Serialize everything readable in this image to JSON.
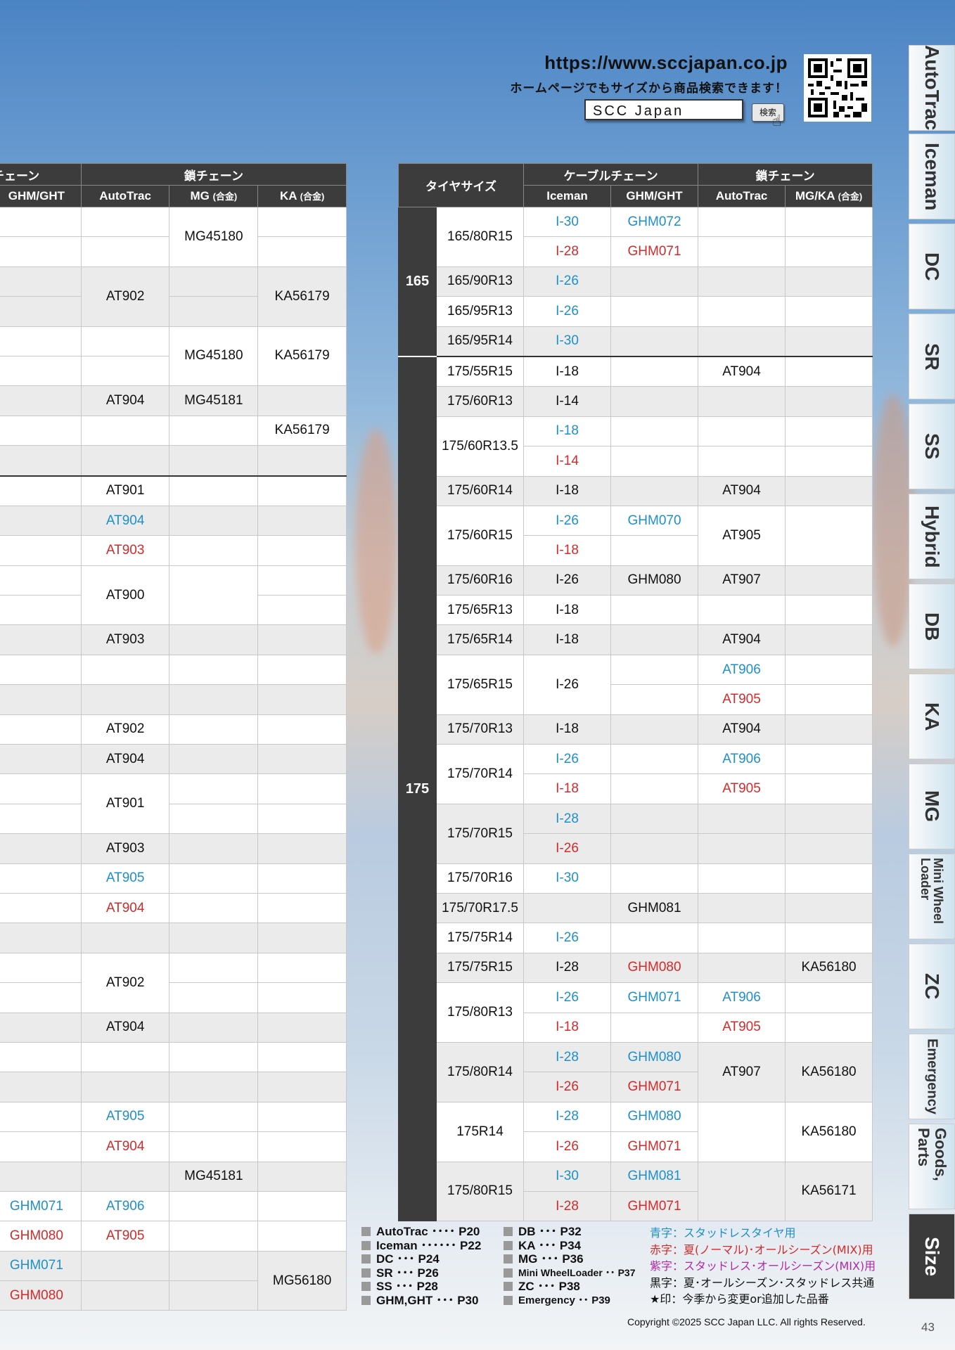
{
  "header": {
    "url": "https://www.sccjapan.co.jp",
    "tagline": "ホームページでもサイズから商品検索できます！",
    "search_text": "SCC Japan",
    "search_button": "検索"
  },
  "left_table": {
    "group_headers": [
      "チェーン",
      "鎖チェーン"
    ],
    "columns": [
      "GHM/GHT",
      "AutoTrac",
      "MG",
      "(合金)",
      "KA",
      "(合金)"
    ],
    "rows": [
      [
        "",
        "",
        "MG45180",
        ""
      ],
      [
        "",
        "",
        "",
        ""
      ],
      [
        "",
        "AT902",
        "",
        "KA56179"
      ],
      [
        "",
        "",
        "",
        ""
      ],
      [
        "",
        "",
        "MG45180",
        "KA56179"
      ],
      [
        "",
        "",
        "",
        ""
      ],
      [
        "",
        "AT904",
        "MG45181",
        ""
      ],
      [
        "",
        "",
        "",
        "KA56179"
      ],
      [
        "",
        "",
        "",
        ""
      ],
      [
        "",
        "AT901",
        "",
        ""
      ],
      [
        "",
        "AT904",
        "",
        ""
      ],
      [
        "",
        "AT903",
        "",
        ""
      ],
      [
        "",
        "AT900",
        "",
        ""
      ],
      [
        "",
        "",
        "",
        ""
      ],
      [
        "",
        "AT903",
        "",
        ""
      ],
      [
        "",
        "",
        "",
        ""
      ],
      [
        "",
        "",
        "",
        ""
      ],
      [
        "",
        "AT902",
        "",
        ""
      ],
      [
        "",
        "AT904",
        "",
        ""
      ],
      [
        "",
        "AT901",
        "",
        ""
      ],
      [
        "",
        "",
        "",
        ""
      ],
      [
        "",
        "AT903",
        "",
        ""
      ],
      [
        "",
        "AT905",
        "",
        ""
      ],
      [
        "",
        "AT904",
        "",
        ""
      ],
      [
        "",
        "",
        "",
        ""
      ],
      [
        "",
        "AT902",
        "",
        ""
      ],
      [
        "",
        "",
        "",
        ""
      ],
      [
        "",
        "AT904",
        "",
        ""
      ],
      [
        "",
        "",
        "",
        ""
      ],
      [
        "",
        "",
        "",
        ""
      ],
      [
        "",
        "AT905",
        "",
        ""
      ],
      [
        "",
        "AT904",
        "",
        ""
      ],
      [
        "",
        "",
        "MG45181",
        ""
      ],
      [
        "GHM071",
        "AT906",
        "",
        ""
      ],
      [
        "GHM080",
        "AT905",
        "",
        ""
      ],
      [
        "GHM071",
        "",
        "",
        "MG56180"
      ],
      [
        "GHM080",
        "",
        "",
        ""
      ]
    ]
  },
  "right_table": {
    "headers": {
      "size": "タイヤサイズ",
      "cable": "ケーブルチェーン",
      "chain": "鎖チェーン",
      "iceman": "Iceman",
      "ghm": "GHM/GHT",
      "autotrac": "AutoTrac",
      "mgka": "MG/KA",
      "alloy": "(合金)"
    },
    "groups": [
      "165",
      "175"
    ],
    "sizes": [
      "165/80R15",
      "165/90R13",
      "165/95R13",
      "165/95R14",
      "175/55R15",
      "175/60R13",
      "175/60R13.5",
      "175/60R14",
      "175/60R15",
      "175/60R16",
      "175/65R13",
      "175/65R14",
      "175/65R15",
      "175/70R13",
      "175/70R14",
      "175/70R15",
      "175/70R16",
      "175/70R17.5",
      "175/75R14",
      "175/75R15",
      "175/80R13",
      "175/80R14",
      "175R14",
      "175/80R15"
    ],
    "iceman": [
      "I-30",
      "I-28",
      "I-26",
      "I-26",
      "I-30",
      "I-18",
      "I-14",
      "I-18",
      "I-14",
      "I-18",
      "I-26",
      "I-18",
      "I-26",
      "I-18",
      "I-18",
      "I-26",
      "I-18",
      "I-26",
      "I-18",
      "I-28",
      "I-26",
      "I-30",
      "I-26",
      "I-28",
      "I-26",
      "I-18",
      "I-28",
      "I-26",
      "I-28",
      "I-26",
      "I-30",
      "I-28"
    ],
    "ghm": [
      "GHM072",
      "GHM071",
      "GHM070",
      "GHM080",
      "GHM081",
      "GHM080",
      "GHM071",
      "GHM080",
      "GHM071",
      "GHM080",
      "GHM071",
      "GHM081",
      "GHM071"
    ],
    "autotrac": [
      "AT904",
      "AT904",
      "AT905",
      "AT907",
      "AT904",
      "AT906",
      "AT905",
      "AT904",
      "AT906",
      "AT905",
      "AT906",
      "AT905",
      "AT907"
    ],
    "mgka": [
      "KA56180",
      "KA56180",
      "KA56180",
      "KA56171"
    ]
  },
  "tabs": [
    "AutoTrac",
    "Iceman",
    "DC",
    "SR",
    "SS",
    "Hybrid",
    "DB",
    "KA",
    "MG",
    "Mini Wheel Loader",
    "ZC",
    "Emergency",
    "Goods, Parts",
    "Size"
  ],
  "legend_left": [
    "AutoTrac ････ P20",
    "Iceman ･･････ P22",
    "DC ･･･ P24",
    "SR ･･･ P26",
    "SS ･･･ P28",
    "GHM,GHT ･･･ P30"
  ],
  "legend_mid": [
    "DB ･･･ P32",
    "KA ･･･ P34",
    "MG ･･･ P36",
    "Mini WheelLoader ･･ P37",
    "ZC ･･･ P38",
    "Emergency ･･ P39"
  ],
  "notes": {
    "blue": "青字：スタッドレスタイヤ用",
    "red": "赤字：夏(ノーマル)･オールシーズン(MIX)用",
    "purple": "紫字：スタッドレス･オールシーズン(MIX)用",
    "black": "黒字：夏･オールシーズン･スタッドレス共通",
    "star": "★印：今季から変更or追加した品番"
  },
  "copyright": "Copyright ©2025 SCC Japan LLC. All rights Reserved.",
  "page_number": "43",
  "colors": {
    "blue": "#1e8fca",
    "red": "#d42a2a",
    "purple": "#b02aa8",
    "header": "#3c3c3c"
  }
}
